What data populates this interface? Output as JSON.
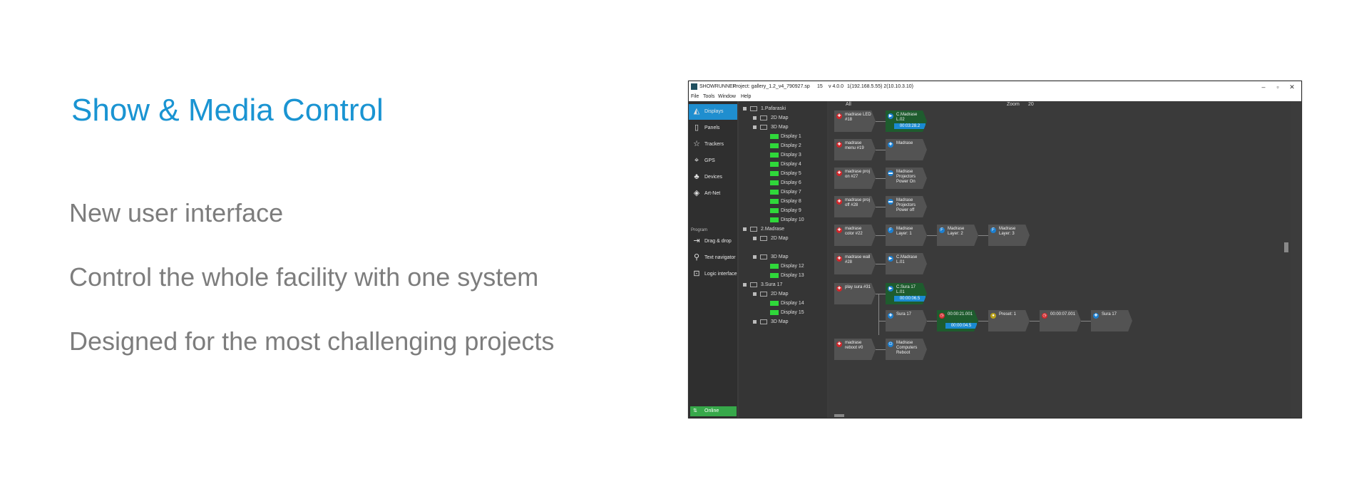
{
  "slide": {
    "headline": "Show & Media Control",
    "bullets": [
      "New user interface",
      "Control the whole facility with one system",
      "Designed for the most challenging projects"
    ],
    "headline_color": "#1a94d2"
  },
  "app": {
    "titlebar": {
      "app_name": "SHOWRUNNER",
      "project": "Project: gallery_1.2_v4_790927.sp",
      "count": "15",
      "version": "v 4.0.0",
      "servers": "1(192.168.5.55) 2(10.10.3.10)",
      "minimize": "–",
      "maximize": "▫",
      "close": "✕"
    },
    "menu": [
      "File",
      "Tools",
      "Window",
      "Help"
    ],
    "sidebar": {
      "items": [
        {
          "label": "Displays",
          "icon": "display-icon",
          "glyph": "◭"
        },
        {
          "label": "Panels",
          "icon": "tablet-icon",
          "glyph": "▯"
        },
        {
          "label": "Trackers",
          "icon": "person-icon",
          "glyph": "☆"
        },
        {
          "label": "GPS",
          "icon": "location-pin-icon",
          "glyph": "⌖"
        },
        {
          "label": "Devices",
          "icon": "network-icon",
          "glyph": "♣"
        },
        {
          "label": "Art-Net",
          "icon": "artnet-icon",
          "glyph": "◈"
        }
      ],
      "program_label": "Program",
      "program_items": [
        {
          "label": "Drag & drop",
          "icon": "drag-drop-icon",
          "glyph": "⇥"
        },
        {
          "label": "Text navigator",
          "icon": "search-icon",
          "glyph": "⚲"
        },
        {
          "label": "Logic interface",
          "icon": "logic-icon",
          "glyph": "⊡"
        }
      ],
      "online_label": "Online",
      "online_glyph": "⇅",
      "accent_color": "#1f8ecf",
      "online_color": "#37a84a"
    },
    "tree": {
      "rows": [
        {
          "text": "1.Pafaraski",
          "kind": "group",
          "level": 0
        },
        {
          "text": "2D Map",
          "kind": "map",
          "level": 1
        },
        {
          "text": "3D Map",
          "kind": "map",
          "level": 1
        },
        {
          "text": "Display 1",
          "kind": "display",
          "level": 2
        },
        {
          "text": "Display 2",
          "kind": "display",
          "level": 2
        },
        {
          "text": "Display 3",
          "kind": "display",
          "level": 2
        },
        {
          "text": "Display 4",
          "kind": "display",
          "level": 2
        },
        {
          "text": "Display 5",
          "kind": "display",
          "level": 2
        },
        {
          "text": "Display 6",
          "kind": "display",
          "level": 2
        },
        {
          "text": "Display 7",
          "kind": "display",
          "level": 2
        },
        {
          "text": "Display 8",
          "kind": "display",
          "level": 2
        },
        {
          "text": "Display 9",
          "kind": "display",
          "level": 2
        },
        {
          "text": "Display 10",
          "kind": "display",
          "level": 2
        },
        {
          "text": "2.Madrase",
          "kind": "group",
          "level": 0
        },
        {
          "text": "2D Map",
          "kind": "map",
          "level": 1
        },
        {
          "text": "",
          "kind": "spacer",
          "level": 1
        },
        {
          "text": "3D Map",
          "kind": "map",
          "level": 1
        },
        {
          "text": "Display 12",
          "kind": "display",
          "level": 2
        },
        {
          "text": "Display 13",
          "kind": "display",
          "level": 2
        },
        {
          "text": "3.Sura 17",
          "kind": "group",
          "level": 0
        },
        {
          "text": "2D Map",
          "kind": "map",
          "level": 1
        },
        {
          "text": "Display 14",
          "kind": "display",
          "level": 2
        },
        {
          "text": "Display 15",
          "kind": "display",
          "level": 2
        },
        {
          "text": "3D Map",
          "kind": "map",
          "level": 1
        }
      ]
    },
    "canvas": {
      "header_all": "All",
      "zoom_label": "Zoom",
      "zoom_value": "20",
      "rows": [
        {
          "nodes": [
            {
              "title": "madrase LED #18",
              "icon": "red",
              "glyph": "✚"
            },
            {
              "title": "C.Madrase L.02",
              "icon": "blue",
              "glyph": "▶",
              "green": true,
              "bar": "00:03:28.2"
            }
          ]
        },
        {
          "nodes": [
            {
              "title": "madrase menu #19",
              "icon": "red",
              "glyph": "✚"
            },
            {
              "title": "Madrase",
              "icon": "blue",
              "glyph": "✚"
            }
          ]
        },
        {
          "nodes": [
            {
              "title": "madrase proj on #27",
              "icon": "red",
              "glyph": "✚"
            },
            {
              "title": "Madrase Projectors Power On",
              "icon": "blue",
              "glyph": "▬"
            }
          ]
        },
        {
          "nodes": [
            {
              "title": "madrase proj off #28",
              "icon": "red",
              "glyph": "✚"
            },
            {
              "title": "Madrase Projectors Power off",
              "icon": "blue",
              "glyph": "▬"
            }
          ]
        },
        {
          "nodes": [
            {
              "title": "madrase color #22",
              "icon": "red",
              "glyph": "✚"
            },
            {
              "title": "Madrase Layer: 1",
              "icon": "blue",
              "glyph": "F"
            },
            {
              "title": "Madrase Layer: 2",
              "icon": "blue",
              "glyph": "F"
            },
            {
              "title": "Madrase Layer: 3",
              "icon": "blue",
              "glyph": "F"
            }
          ]
        },
        {
          "nodes": [
            {
              "title": "madrase wall #28",
              "icon": "red",
              "glyph": "✚"
            },
            {
              "title": "C.Madrase L.01",
              "icon": "blue",
              "glyph": "▶"
            }
          ]
        },
        {
          "nodes": [
            {
              "title": "play sura #31",
              "icon": "red",
              "glyph": "✚"
            },
            {
              "title": "C.Sura 17 L.01",
              "icon": "blue",
              "glyph": "▶",
              "green": true,
              "bar": "00:00:06.5"
            }
          ]
        },
        {
          "nodes": [
            {
              "title": "Sura 17",
              "icon": "blue",
              "glyph": "✚"
            },
            {
              "title": "00:00:21.001",
              "icon": "red",
              "glyph": "◷",
              "green": true,
              "bar": "00:00:04.5"
            },
            {
              "title": "Preset: 1",
              "icon": "yellow",
              "glyph": "●"
            },
            {
              "title": "00:00:07.001",
              "icon": "red",
              "glyph": "◷"
            },
            {
              "title": "Sura 17",
              "icon": "blue",
              "glyph": "✚"
            }
          ]
        },
        {
          "nodes": [
            {
              "title": "madrase reboot #0",
              "icon": "red",
              "glyph": "✚"
            },
            {
              "title": "Madrase Computers Reboot",
              "icon": "blue",
              "glyph": "⏻"
            }
          ]
        }
      ]
    }
  }
}
